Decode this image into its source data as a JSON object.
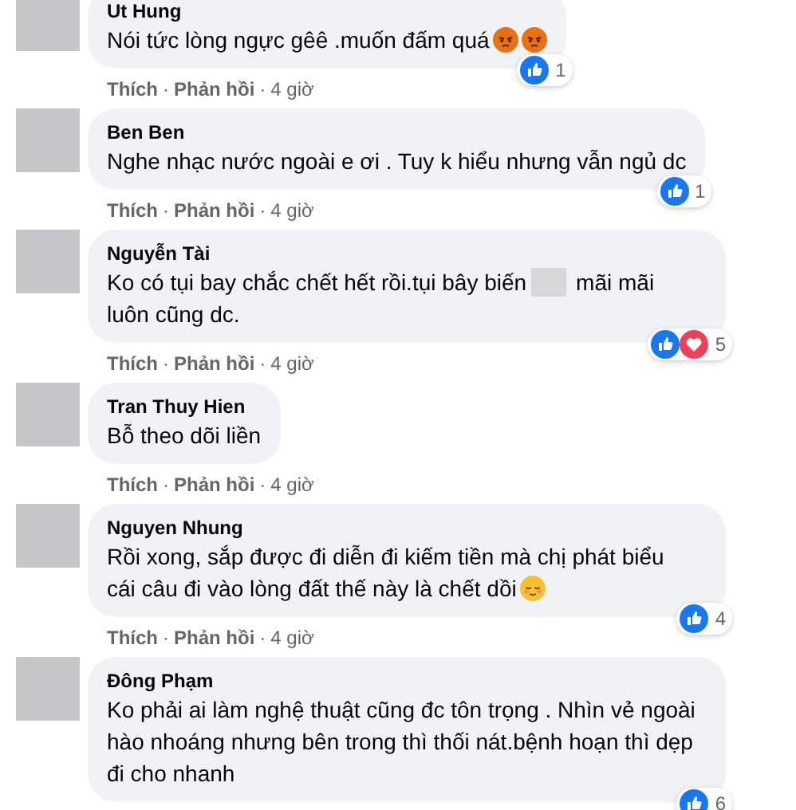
{
  "comments": [
    {
      "author": "Ut Hung",
      "body": [
        {
          "kind": "text",
          "text": "Nói tức lòng ngực gêê .muốn đấm quá"
        },
        {
          "kind": "angry_emoji"
        },
        {
          "kind": "angry_emoji"
        }
      ],
      "reactions": [
        {
          "kind": "like"
        }
      ],
      "reaction_count": "1",
      "actions": [
        {
          "kind": "link",
          "text": "Thích"
        },
        {
          "kind": "separator",
          "text": "·"
        },
        {
          "kind": "link",
          "text": "Phản hồi"
        },
        {
          "kind": "separator",
          "text": "·"
        },
        {
          "kind": "time",
          "text": "4 giờ"
        }
      ]
    },
    {
      "author": "Ben Ben",
      "body": [
        {
          "kind": "text",
          "text": "Nghe nhạc nước ngoài e ơi . Tuy k hiểu nhưng vẫn ngủ dc"
        }
      ],
      "reactions": [
        {
          "kind": "like"
        }
      ],
      "reaction_count": "1",
      "actions": [
        {
          "kind": "link",
          "text": "Thích"
        },
        {
          "kind": "separator",
          "text": "·"
        },
        {
          "kind": "link",
          "text": "Phản hồi"
        },
        {
          "kind": "separator",
          "text": "·"
        },
        {
          "kind": "time",
          "text": "4 giờ"
        }
      ]
    },
    {
      "author": "Nguyễn Tài",
      "body": [
        {
          "kind": "text",
          "text": "Ko có tụi bay chắc chết hết rồi.tụi bây biến"
        },
        {
          "kind": "redaction"
        },
        {
          "kind": "text",
          "text": "mãi mãi"
        },
        {
          "kind": "text",
          "text": "luôn cũng dc."
        }
      ],
      "reactions": [
        {
          "kind": "like"
        },
        {
          "kind": "love"
        }
      ],
      "reaction_count": "5",
      "actions": [
        {
          "kind": "link",
          "text": "Thích"
        },
        {
          "kind": "separator",
          "text": "·"
        },
        {
          "kind": "link",
          "text": "Phản hồi"
        },
        {
          "kind": "separator",
          "text": "·"
        },
        {
          "kind": "time",
          "text": "4 giờ"
        }
      ]
    },
    {
      "author": "Tran Thuy Hien",
      "body": [
        {
          "kind": "text",
          "text": "Bỗ theo dõi liền"
        }
      ],
      "actions": [
        {
          "kind": "link",
          "text": "Thích"
        },
        {
          "kind": "separator",
          "text": "·"
        },
        {
          "kind": "link",
          "text": "Phản hồi"
        },
        {
          "kind": "separator",
          "text": "·"
        },
        {
          "kind": "time",
          "text": "4 giờ"
        }
      ]
    },
    {
      "author": "Nguyen Nhung",
      "body": [
        {
          "kind": "text",
          "text": "Rồi xong, sắp được đi diễn đi kiếm tiền mà chị phát biểu"
        },
        {
          "kind": "text",
          "text": "cái câu đi vào lòng đất thế này là chết dồi"
        },
        {
          "kind": "relieved_emoji"
        }
      ],
      "reactions": [
        {
          "kind": "like"
        }
      ],
      "reaction_count": "4",
      "actions": [
        {
          "kind": "link",
          "text": "Thích"
        },
        {
          "kind": "separator",
          "text": "·"
        },
        {
          "kind": "link",
          "text": "Phản hồi"
        },
        {
          "kind": "separator",
          "text": "·"
        },
        {
          "kind": "time",
          "text": "4 giờ"
        }
      ]
    },
    {
      "author": "Đông Phạm",
      "body": [
        {
          "kind": "text",
          "text": "Ko phải ai làm nghệ thuật cũng đc tôn trọng . Nhìn vẻ ngoài hào nhoáng nhưng bên trong thì thối nát.bệnh hoạn thì dẹp đi cho nhanh"
        }
      ],
      "reactions": [
        {
          "kind": "like"
        }
      ],
      "reaction_count": "6"
    }
  ]
}
